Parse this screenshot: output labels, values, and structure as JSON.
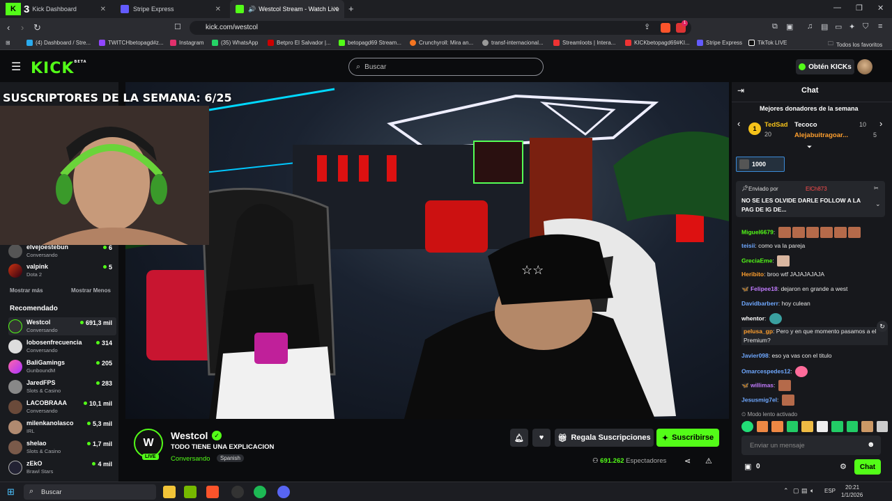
{
  "browser": {
    "tabs": [
      {
        "label": "Kick Dashboard",
        "badge": "3",
        "active": false
      },
      {
        "label": "Stripe Express",
        "active": false
      },
      {
        "label": "Westcol Stream - Watch Live",
        "active": true
      }
    ],
    "new_tab": "+",
    "url": "kick.com/westcol",
    "bookmarks": [
      "(4) Dashboard / Stre...",
      "TWITCHbetopagd#z...",
      "Instagram",
      "(35) WhatsApp",
      "Betpro El Salvador |...",
      "betopagd69 Stream...",
      "Crunchyroll: Mira an...",
      "transf-internacional...",
      "Streamloots | Intera...",
      "KICKbetopagd69#KI...",
      "Stripe Express",
      "TikTok LIVE"
    ],
    "all_favorites": "Todos los favoritos",
    "extension_badge": "1"
  },
  "header": {
    "logo": "KICK",
    "logo_beta": "BETA",
    "search_placeholder": "Buscar",
    "get_kicks": "Obtén KICKs"
  },
  "overlay": {
    "text": "SUSCRIPTORES DE LA SEMANA: 6/25"
  },
  "sidebar": {
    "following": [
      {
        "name": "elvejoestebun",
        "category": "Conversando",
        "viewers": "6"
      },
      {
        "name": "valpink",
        "category": "Dota 2",
        "viewers": "5"
      }
    ],
    "show_more": "Mostrar más",
    "show_less": "Mostrar Menos",
    "recommended_title": "Recomendado",
    "recommended": [
      {
        "name": "Westcol",
        "category": "Conversando",
        "viewers": "691,3 mil"
      },
      {
        "name": "lobosenfrecuencia",
        "category": "Conversando",
        "viewers": "314"
      },
      {
        "name": "BaliGamings",
        "category": "GunboundM",
        "viewers": "205"
      },
      {
        "name": "JaredFPS",
        "category": "Slots & Casino",
        "viewers": "283"
      },
      {
        "name": "LACOBRAAA",
        "category": "Conversando",
        "viewers": "10,1 mil"
      },
      {
        "name": "milenkanolasco",
        "category": "IRL",
        "viewers": "5,3 mil"
      },
      {
        "name": "shelao",
        "category": "Slots & Casino",
        "viewers": "1,7 mil"
      },
      {
        "name": "zEkO",
        "category": "Brawl Stars",
        "viewers": "4 mil"
      }
    ]
  },
  "stream": {
    "channel": "Westcol",
    "title": "TODO TIENE UNA EXPLICACION",
    "category": "Conversando",
    "language_tag": "Spanish",
    "live_badge": "LIVE",
    "gift_subs": "Regala Suscripciones",
    "subscribe": "Suscribirse",
    "viewers": "691.262",
    "viewers_label": "Espectadores"
  },
  "chat": {
    "title": "Chat",
    "top_donors_title": "Mejores donadores de la semana",
    "donors": [
      {
        "rank": "1",
        "name": "TedSad",
        "amount": "20"
      },
      {
        "name": "Tecoco",
        "amount": "10"
      },
      {
        "name": "Alejabuitragoar...",
        "amount": "5"
      }
    ],
    "gift_amount": "1000",
    "pinned_sender_label": "Enviado por",
    "pinned_sender": "ElCh873",
    "pinned_message": "NO SE LES OLVIDE DARLE FOLLOW A LA PAG DE IG DE...",
    "messages": [
      {
        "user": "Miguel6679",
        "text": "",
        "color": "#53fc18"
      },
      {
        "user": "teisii",
        "text": "como va la pareja",
        "color": "#6fa8ff"
      },
      {
        "user": "GreciaEme",
        "text": "",
        "color": "#53fc18"
      },
      {
        "user": "Heribito",
        "text": "broo wtf JAJAJAJAJA",
        "color": "#ff9f2e"
      },
      {
        "user": "Felipee18",
        "text": "dejaron en grande a west",
        "color": "#c27bff"
      },
      {
        "user": "Davidbarberr",
        "text": "hoy culean",
        "color": "#6fa8ff"
      },
      {
        "user": "whentor",
        "text": "",
        "color": "#ffffff"
      },
      {
        "user": "pelusa_gp",
        "text": "Pero y en que momento pasamos a el Premium?",
        "color": "#ff9f2e"
      },
      {
        "user": "Javier098",
        "text": "eso ya vas con el titulo",
        "color": "#6fa8ff"
      },
      {
        "user": "Omarcespedes12",
        "text": "",
        "color": "#6fa8ff"
      },
      {
        "user": "willimas",
        "text": "",
        "color": "#c27bff"
      },
      {
        "user": "Jesusmig7el",
        "text": "",
        "color": "#6fa8ff"
      }
    ],
    "slow_mode": "Modo lento activado",
    "input_placeholder": "Enviar un mensaje",
    "kicks_count": "0",
    "send": "Chat"
  },
  "taskbar": {
    "search": "Buscar",
    "lang": "ESP",
    "time": "20:21",
    "date": "1/1/2026"
  },
  "colors": {
    "accent": "#53fc18",
    "background": "#0b0c0e",
    "panel": "#191b1f"
  }
}
